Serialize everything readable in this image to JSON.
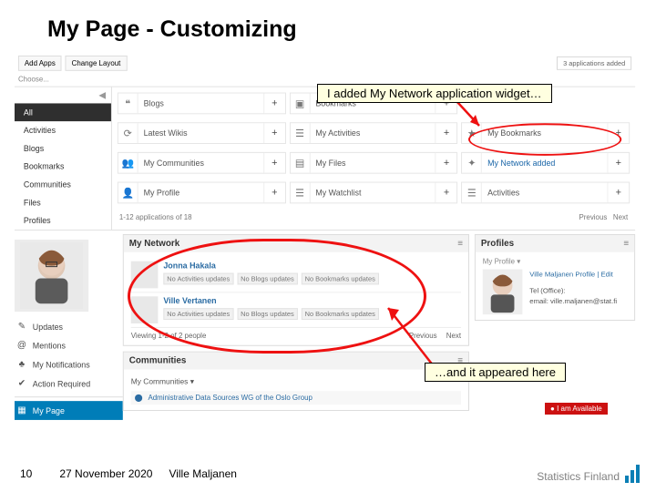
{
  "title": "My Page - Customizing",
  "toolbar": {
    "add_apps": "Add Apps",
    "change_layout": "Change Layout",
    "apps_added": "3 applications added",
    "choose": "Choose..."
  },
  "categories": {
    "items": [
      "All",
      "Activities",
      "Blogs",
      "Bookmarks",
      "Communities",
      "Files",
      "Profiles"
    ],
    "active_index": 0
  },
  "app_grid": {
    "items": [
      {
        "icon": "❝",
        "label": "Blogs"
      },
      {
        "icon": "▣",
        "label": "Bookmarks"
      },
      {
        "icon": "",
        "label": ""
      },
      {
        "icon": "⟳",
        "label": "Latest Wikis"
      },
      {
        "icon": "☰",
        "label": "My Activities"
      },
      {
        "icon": "★",
        "label": "My Bookmarks"
      },
      {
        "icon": "👥",
        "label": "My Communities"
      },
      {
        "icon": "▤",
        "label": "My Files"
      },
      {
        "icon": "✦",
        "label": "My Network added",
        "added": true
      },
      {
        "icon": "👤",
        "label": "My Profile"
      },
      {
        "icon": "☰",
        "label": "My Watchlist"
      },
      {
        "icon": "☰",
        "label": "Activities"
      }
    ],
    "pager_left": "1-12 applications of 18",
    "pager_prev": "Previous",
    "pager_next": "Next"
  },
  "sidebar": {
    "items": [
      {
        "icon": "✎",
        "label": "Updates"
      },
      {
        "icon": "@",
        "label": "Mentions"
      },
      {
        "icon": "♣",
        "label": "My Notifications"
      },
      {
        "icon": "✔",
        "label": "Action Required"
      }
    ],
    "mypage": {
      "icon": "▦",
      "label": "My Page"
    }
  },
  "my_network": {
    "title": "My Network",
    "people": [
      {
        "name": "Jonna Hakala",
        "chips": [
          "No Activities updates",
          "No Blogs updates",
          "No Bookmarks updates"
        ]
      },
      {
        "name": "Ville Vertanen",
        "chips": [
          "No Activities updates",
          "No Blogs updates",
          "No Bookmarks updates"
        ]
      }
    ],
    "viewing": "Viewing 1-2 of 2 people",
    "prev": "Previous",
    "next": "Next"
  },
  "profiles": {
    "title": "Profiles",
    "subtitle": "My Profile ▾",
    "name_line": "Ville Maljanen   Profile | Edit",
    "tel": "Tel (Office):",
    "email": "email: ville.maljanen@stat.fi"
  },
  "communities": {
    "title": "Communities",
    "selector": "My Communities ▾",
    "row_icon": "⬤",
    "row_label": "Administrative Data Sources WG of the Oslo Group"
  },
  "availability": "I am Available",
  "annotations": {
    "top": "I added My Network application widget…",
    "bottom": "…and it appeared here"
  },
  "footer": {
    "page": "10",
    "date": "27 November 2020",
    "author": "Ville Maljanen",
    "brand": "Statistics Finland"
  }
}
